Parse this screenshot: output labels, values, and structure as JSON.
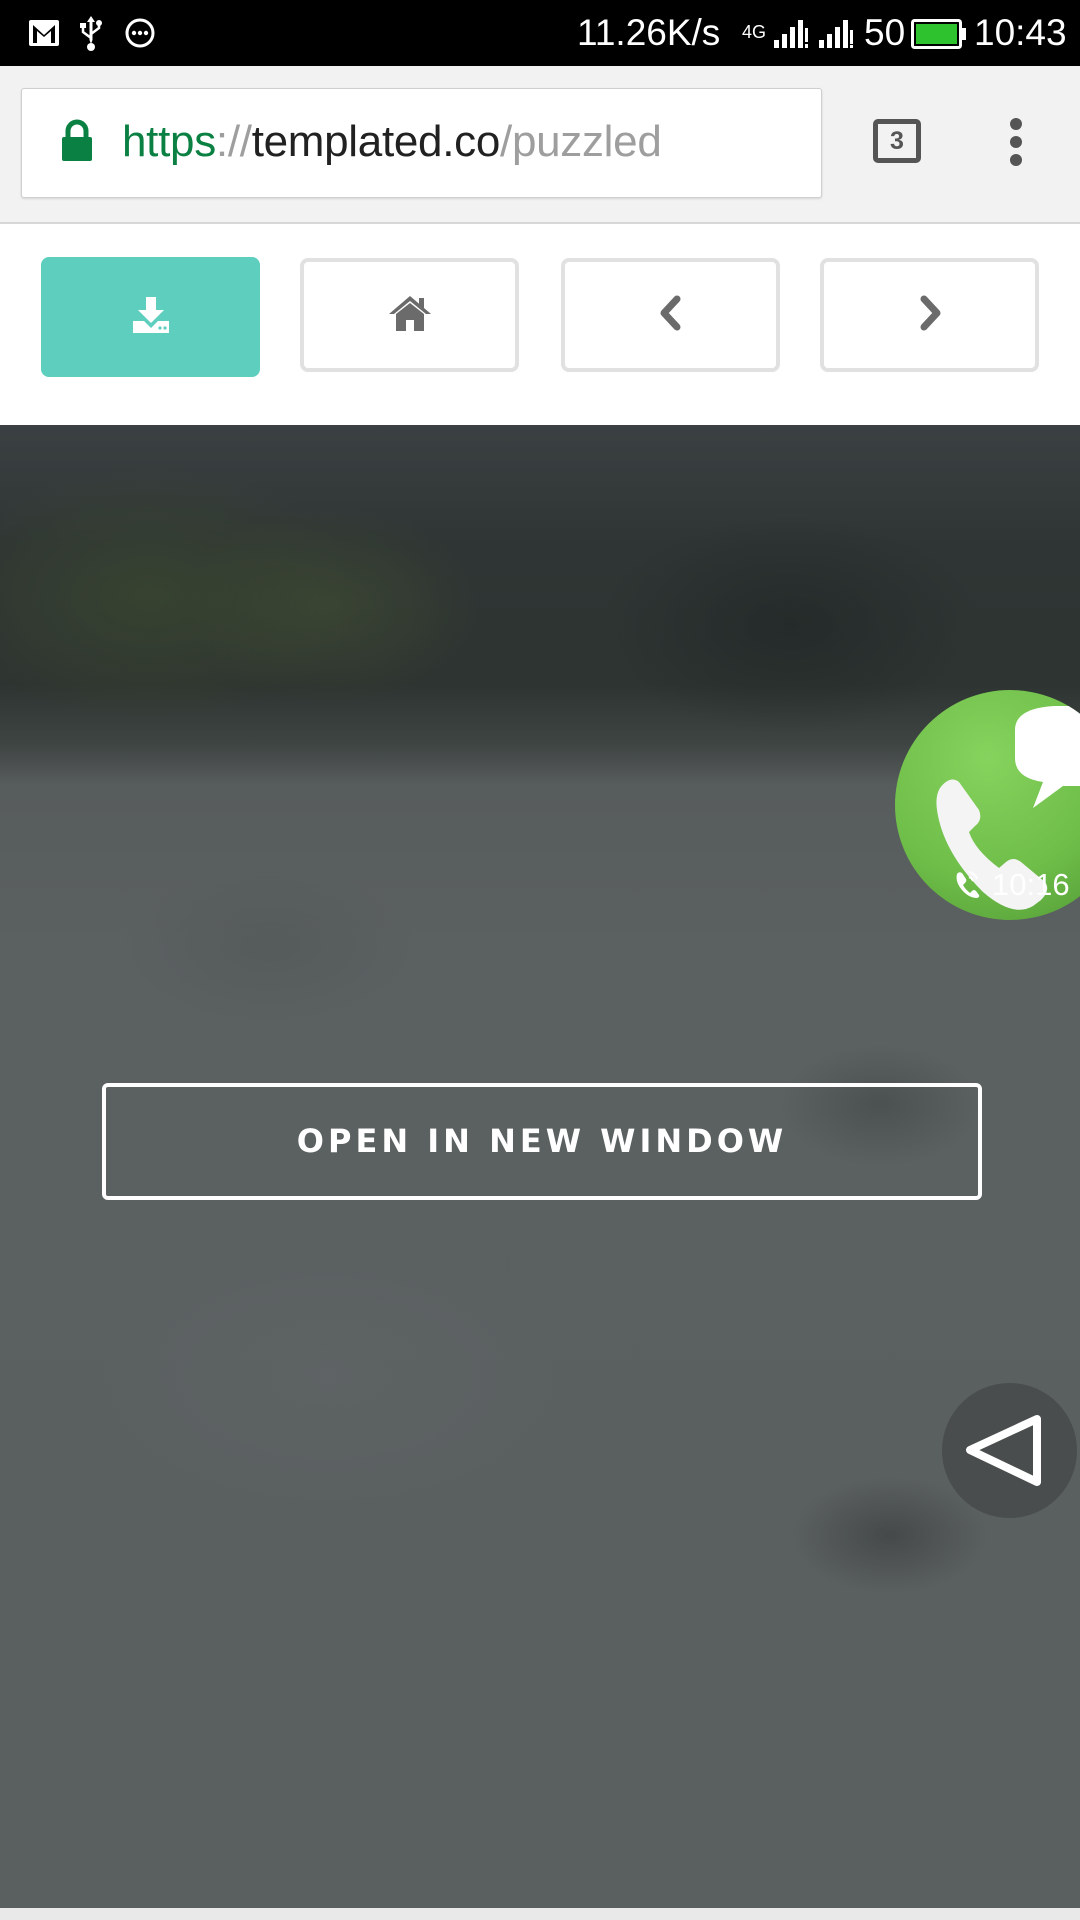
{
  "status_bar": {
    "icons": [
      "gmail-icon",
      "usb-icon",
      "more-icon",
      "signal-4g-icon",
      "signal-roaming-icon",
      "battery-icon"
    ],
    "network_speed": "11.26K/s",
    "network_type": "4G",
    "battery_level": "50",
    "time": "10:43"
  },
  "address_bar": {
    "scheme": "https",
    "separator": "://",
    "host": "templated.co",
    "path": "/puzzled",
    "tab_count": "3"
  },
  "toolbar": {
    "buttons": [
      {
        "icon": "download-icon",
        "active": true
      },
      {
        "icon": "home-icon",
        "active": false
      },
      {
        "icon": "chevron-left-icon",
        "active": false
      },
      {
        "icon": "chevron-right-icon",
        "active": false
      }
    ],
    "accent_color": "#5ecfbe"
  },
  "hero": {
    "open_button_label": "OPEN IN NEW WINDOW"
  },
  "call_overlay": {
    "time": "10:16",
    "color": "#6fbe49"
  },
  "floating_nav": {
    "icon": "back-triangle-icon"
  }
}
